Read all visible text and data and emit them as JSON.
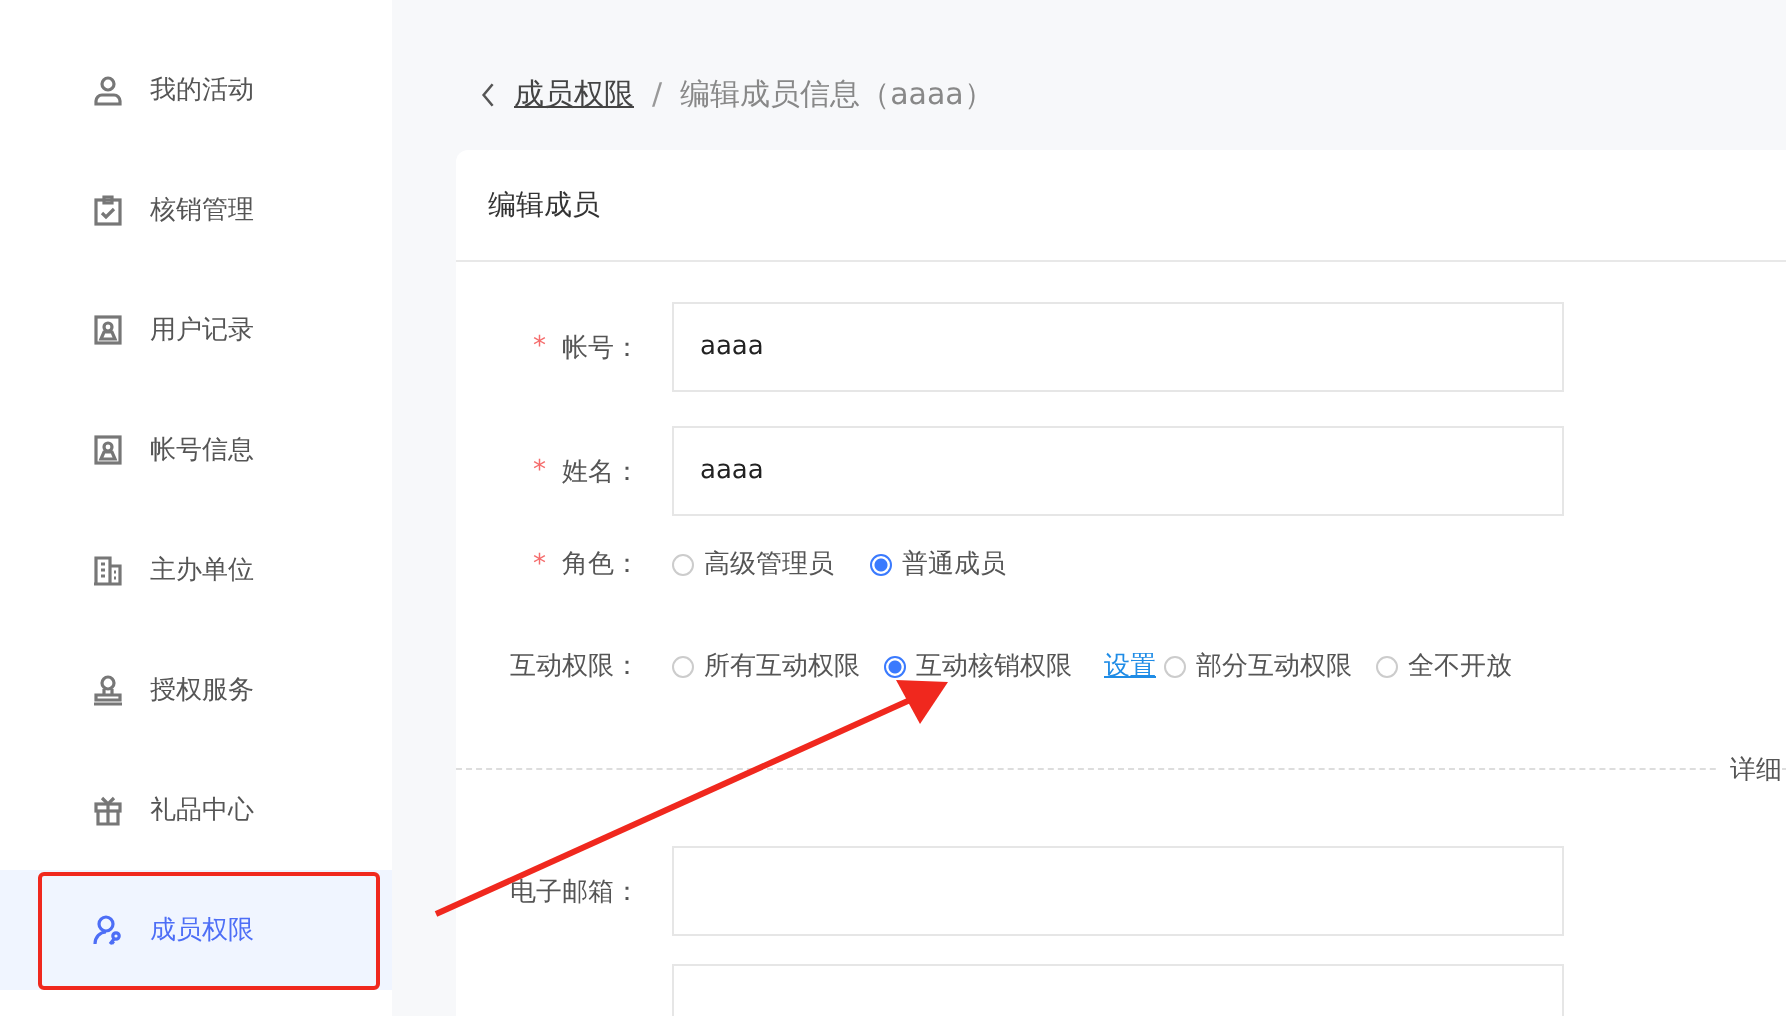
{
  "sidebar": {
    "items": [
      {
        "label": "我的活动",
        "selected": false
      },
      {
        "label": "核销管理",
        "selected": false
      },
      {
        "label": "用户记录",
        "selected": false
      },
      {
        "label": "帐号信息",
        "selected": false
      },
      {
        "label": "主办单位",
        "selected": false
      },
      {
        "label": "授权服务",
        "selected": false
      },
      {
        "label": "礼品中心",
        "selected": false
      },
      {
        "label": "成员权限",
        "selected": true
      }
    ]
  },
  "breadcrumb": {
    "parent": "成员权限",
    "separator": "/",
    "current": "编辑成员信息（aaaa）"
  },
  "card": {
    "title": "编辑成员",
    "account": {
      "required_mark": "*",
      "label": "帐号：",
      "value": "aaaa"
    },
    "name": {
      "required_mark": "*",
      "label": "姓名：",
      "value": "aaaa"
    },
    "role": {
      "required_mark": "*",
      "label": "角色：",
      "options": [
        {
          "label": "高级管理员",
          "selected": false
        },
        {
          "label": "普通成员",
          "selected": true
        }
      ]
    },
    "interaction": {
      "label": "互动权限：",
      "options": [
        {
          "label": "所有互动权限",
          "selected": false
        },
        {
          "label": "互动核销权限",
          "selected": true,
          "link": "设置"
        },
        {
          "label": "部分互动权限",
          "selected": false
        },
        {
          "label": "全不开放",
          "selected": false
        }
      ]
    },
    "section_label": "详细",
    "email": {
      "label": "电子邮箱："
    }
  }
}
